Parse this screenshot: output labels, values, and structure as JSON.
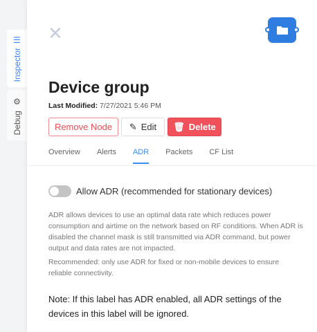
{
  "side_tabs": {
    "inspector": "Inspector",
    "debug": "Debug"
  },
  "header": {
    "title": "Device group",
    "last_modified_label": "Last Modified:",
    "last_modified_value": "7/27/2021 5:46 PM"
  },
  "buttons": {
    "remove": "Remove Node",
    "edit": "Edit",
    "delete": "Delete"
  },
  "tabs": [
    "Overview",
    "Alerts",
    "ADR",
    "Packets",
    "CF List"
  ],
  "active_tab": "ADR",
  "adr": {
    "toggle_label": "Allow ADR (recommended for stationary devices)",
    "enabled": false,
    "description": "ADR allows devices to use an optimal data rate which reduces power consumption and airtime on the network based on RF conditions. When ADR is disabled the channel mask is still transmitted via ADR command, but power output and data rates are not impacted.",
    "recommendation": "Recommended: only use ADR for fixed or non-mobile devices to ensure reliable connectivity.",
    "note": "Note: If this label has ADR enabled, all ADR settings of the devices in this label will be ignored."
  },
  "colors": {
    "accent": "#3b8cf0",
    "danger": "#f0515a",
    "node": "#2f7de1"
  }
}
